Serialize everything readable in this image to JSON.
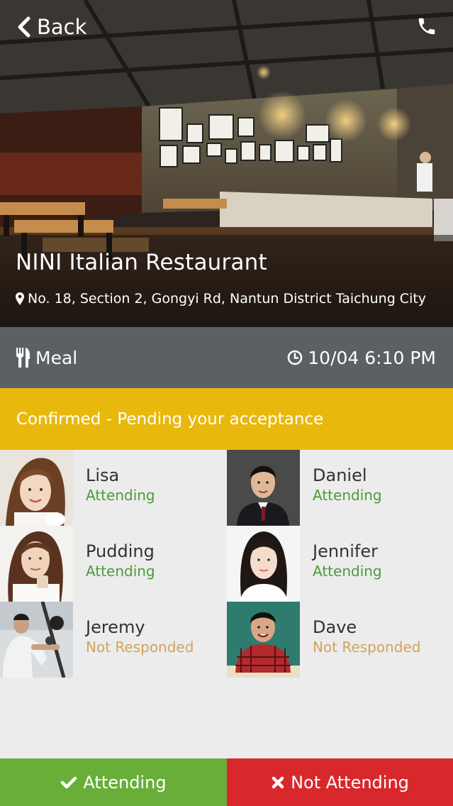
{
  "nav": {
    "back_label": "Back"
  },
  "restaurant": {
    "name": "NINI Italian Restaurant",
    "address": "No. 18, Section 2, Gongyi Rd, Nantun District Taichung City"
  },
  "event": {
    "type": "Meal",
    "datetime": "10/04 6:10 PM"
  },
  "status_text": "Confirmed - Pending your acceptance",
  "guests": [
    {
      "name": "Lisa",
      "status": "Attending"
    },
    {
      "name": "Daniel",
      "status": "Attending"
    },
    {
      "name": "Pudding",
      "status": "Attending"
    },
    {
      "name": "Jennifer",
      "status": "Attending"
    },
    {
      "name": "Jeremy",
      "status": "Not Responded"
    },
    {
      "name": "Dave",
      "status": "Not Responded"
    }
  ],
  "actions": {
    "accept_label": "Attending",
    "decline_label": "Not Attending"
  },
  "colors": {
    "info_bar": "#5b6065",
    "status_bar": "#e9b80d",
    "attending": "#4c9a3b",
    "not_responded": "#d2a35b",
    "accept_button": "#6aae3a",
    "decline_button": "#d8282c"
  },
  "icons": {
    "back": "chevron-left-icon",
    "call": "phone-icon",
    "location": "map-pin-icon",
    "meal": "cutlery-icon",
    "time": "clock-icon",
    "accept": "check-icon",
    "decline": "x-icon"
  }
}
